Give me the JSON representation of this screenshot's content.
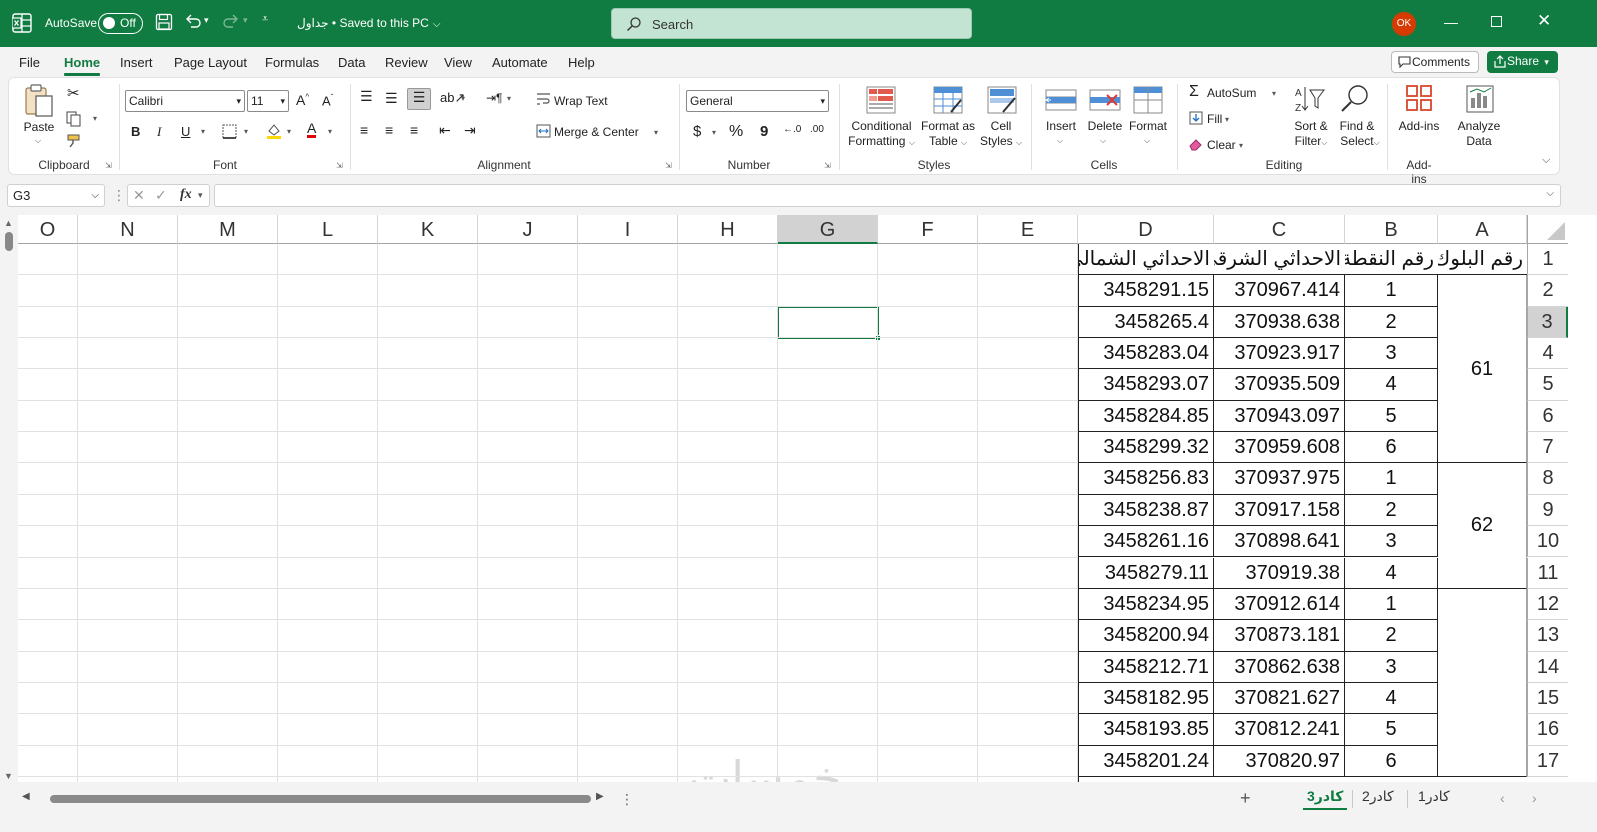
{
  "titlebar": {
    "autosave_label": "AutoSave",
    "autosave_state": "Off",
    "doc_title": "جداول • Saved to this PC",
    "search_placeholder": "Search",
    "user_initials": "OK"
  },
  "menu": {
    "tabs": [
      "File",
      "Home",
      "Insert",
      "Page Layout",
      "Formulas",
      "Data",
      "Review",
      "View",
      "Automate",
      "Help"
    ],
    "active": "Home",
    "comments_label": "Comments",
    "share_label": "Share"
  },
  "ribbon": {
    "clipboard": {
      "paste": "Paste",
      "label": "Clipboard"
    },
    "font": {
      "name": "Calibri",
      "size": "11",
      "label": "Font",
      "bold": "B",
      "italic": "I",
      "underline": "U"
    },
    "alignment": {
      "wrap": "Wrap Text",
      "merge": "Merge & Center",
      "label": "Alignment"
    },
    "number": {
      "format": "General",
      "currency": "$",
      "percent": "%",
      "comma": "9",
      "label": "Number"
    },
    "styles": {
      "conditional": "Conditional",
      "conditional2": "Formatting",
      "format_as": "Format as",
      "format_as2": "Table",
      "cell": "Cell",
      "cell2": "Styles",
      "label": "Styles"
    },
    "cells": {
      "insert": "Insert",
      "delete": "Delete",
      "format": "Format",
      "label": "Cells"
    },
    "editing": {
      "autosum": "AutoSum",
      "fill": "Fill",
      "clear": "Clear",
      "sort": "Sort &",
      "sort2": "Filter",
      "find": "Find &",
      "find2": "Select",
      "label": "Editing"
    },
    "addins": {
      "addins": "Add-ins",
      "analyze": "Analyze",
      "analyze2": "Data",
      "label": "Add-ins"
    }
  },
  "formula_bar": {
    "name_box": "G3",
    "fx": "fx",
    "content": ""
  },
  "sheet": {
    "columns": [
      "O",
      "N",
      "M",
      "L",
      "K",
      "J",
      "I",
      "H",
      "G",
      "F",
      "E",
      "D",
      "C",
      "B",
      "A"
    ],
    "rows": [
      "1",
      "2",
      "3",
      "4",
      "5",
      "6",
      "7",
      "8",
      "9",
      "10",
      "11",
      "12",
      "13",
      "14",
      "15",
      "16",
      "17"
    ],
    "selected_col": "G",
    "selected_row": "3",
    "headers": {
      "A": "رقم البلوك",
      "B": "رقم النقطة",
      "C": "الاحداثي الشرقي",
      "D": "الاحداثي الشمالي"
    },
    "data": [
      {
        "B": "1",
        "C": "370967.414",
        "D": "3458291.15"
      },
      {
        "B": "2",
        "C": "370938.638",
        "D": "3458265.4"
      },
      {
        "B": "3",
        "C": "370923.917",
        "D": "3458283.04"
      },
      {
        "B": "4",
        "C": "370935.509",
        "D": "3458293.07"
      },
      {
        "B": "5",
        "C": "370943.097",
        "D": "3458284.85"
      },
      {
        "B": "6",
        "C": "370959.608",
        "D": "3458299.32"
      },
      {
        "B": "1",
        "C": "370937.975",
        "D": "3458256.83"
      },
      {
        "B": "2",
        "C": "370917.158",
        "D": "3458238.87"
      },
      {
        "B": "3",
        "C": "370898.641",
        "D": "3458261.16"
      },
      {
        "B": "4",
        "C": "370919.38",
        "D": "3458279.11"
      },
      {
        "B": "1",
        "C": "370912.614",
        "D": "3458234.95"
      },
      {
        "B": "2",
        "C": "370873.181",
        "D": "3458200.94"
      },
      {
        "B": "3",
        "C": "370862.638",
        "D": "3458212.71"
      },
      {
        "B": "4",
        "C": "370821.627",
        "D": "3458182.95"
      },
      {
        "B": "5",
        "C": "370812.241",
        "D": "3458193.85"
      },
      {
        "B": "6",
        "C": "370820.97",
        "D": "3458201.24"
      }
    ],
    "blocks": [
      {
        "label": "61"
      },
      {
        "label": "62"
      },
      {
        "label": ""
      }
    ],
    "watermark": "خمسات"
  },
  "sheet_tabs": [
    "كادر3",
    "كادر2",
    "كادر1"
  ],
  "active_sheet_tab": "كادر3",
  "colors": {
    "accent": "#107c41",
    "selected_header": "#d2d2d2"
  }
}
